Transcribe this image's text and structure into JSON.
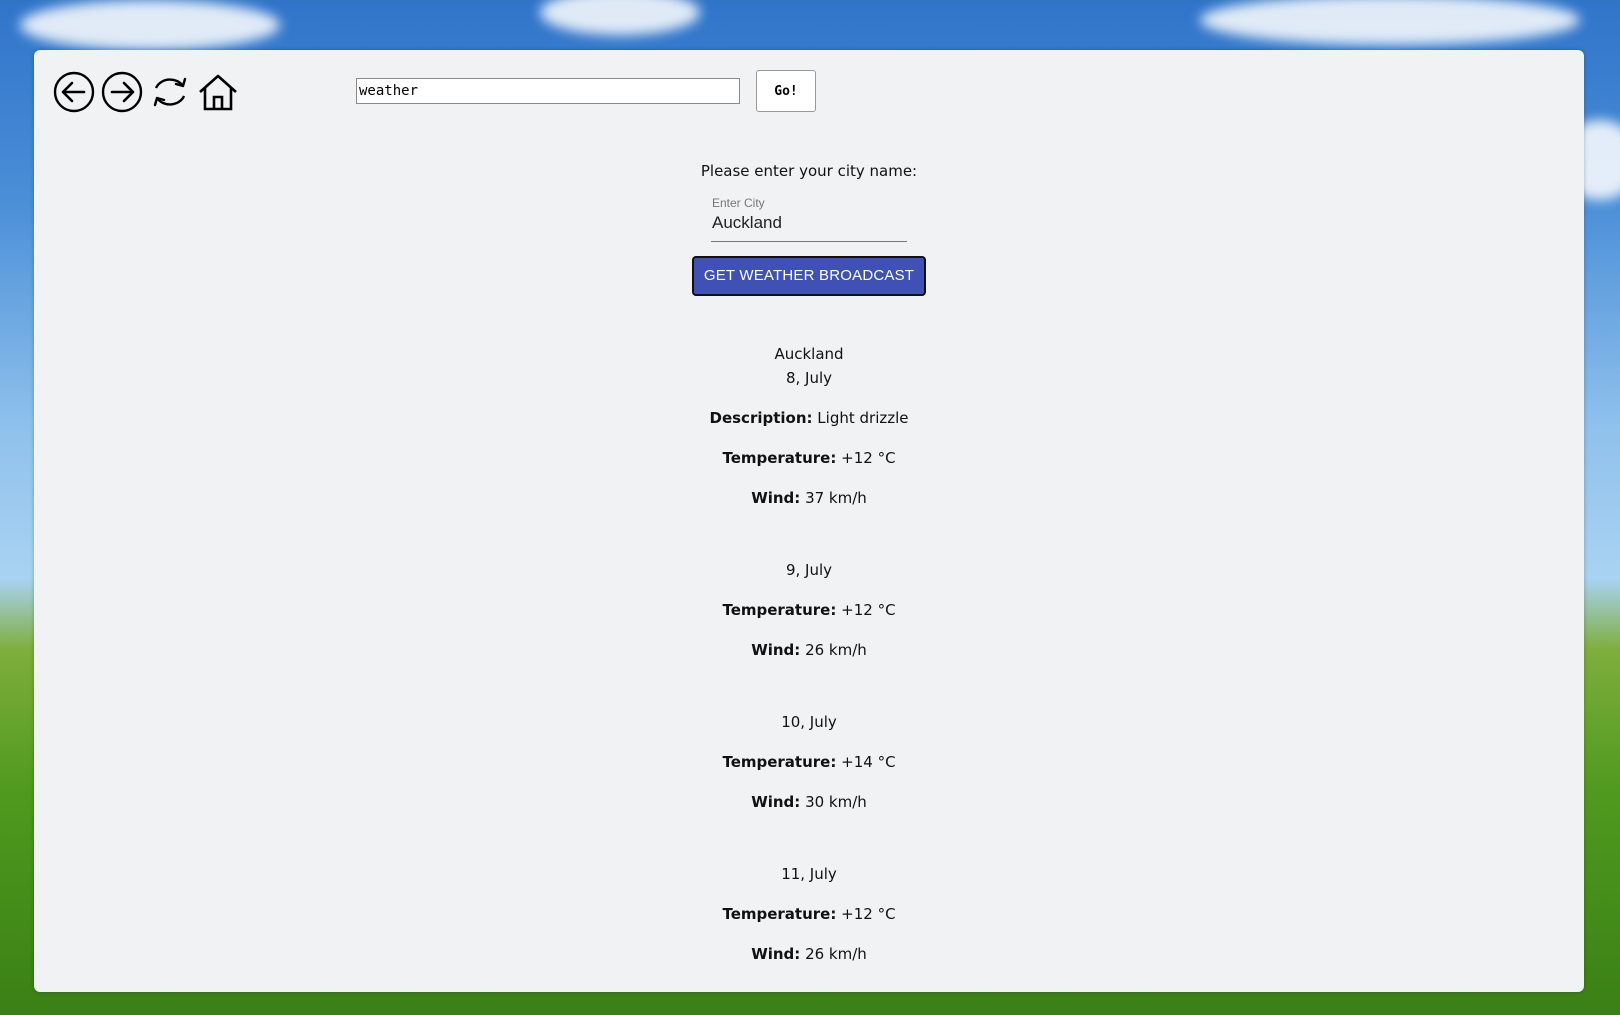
{
  "browser": {
    "url_value": "weather",
    "go_label": "Go!"
  },
  "form": {
    "prompt": "Please enter your city name:",
    "city_label": "Enter City",
    "city_value": "Auckland",
    "button_label": "GET WEATHER BROADCAST"
  },
  "forecast": {
    "city": "Auckland",
    "description_label": "Description:",
    "temperature_label": "Temperature:",
    "wind_label": "Wind:",
    "days": [
      {
        "date": "8, July",
        "description": "Light drizzle",
        "temperature": "+12 °C",
        "wind": "37 km/h"
      },
      {
        "date": "9, July",
        "temperature": "+12 °C",
        "wind": "26 km/h"
      },
      {
        "date": "10, July",
        "temperature": "+14 °C",
        "wind": "30 km/h"
      },
      {
        "date": "11, July",
        "temperature": "+12 °C",
        "wind": "26 km/h"
      }
    ]
  },
  "colors": {
    "button_bg": "#3f51b5",
    "page_bg": "#f1f2f4"
  },
  "icons": [
    "back-arrow-icon",
    "forward-arrow-icon",
    "refresh-icon",
    "home-icon"
  ]
}
